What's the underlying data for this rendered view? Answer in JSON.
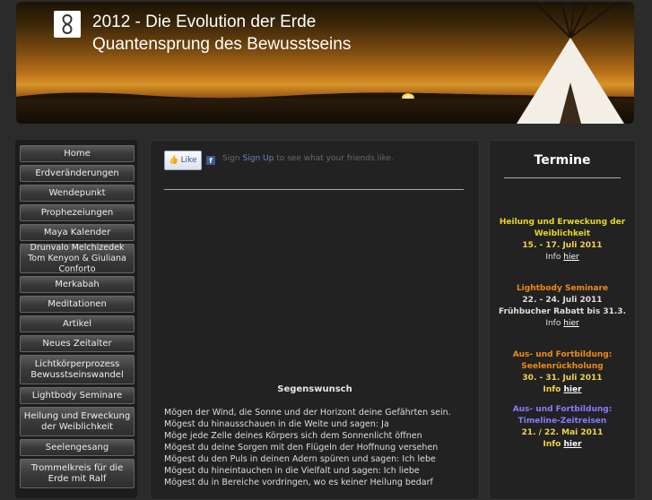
{
  "header": {
    "title_line1": "2012 - Die Evolution der Erde",
    "title_line2": "Quantensprung des Bewusstseins"
  },
  "nav": [
    "Home",
    "Erdveränderungen",
    "Wendepunkt",
    "Prophezeiungen",
    "Maya Kalender",
    "Drunvalo Melchizedek Tom Kenyon & Giuliana Conforto",
    "Merkabah",
    "Meditationen",
    "Artikel",
    "Neues Zeitalter",
    "Lichtkörperprozess Bewusstseinswandel",
    "Lightbody Seminare",
    "Heilung und Erweckung der Weiblichkeit",
    "Seelengesang",
    "Trommelkreis für die Erde mit Ralf"
  ],
  "facebook": {
    "like_label": "Like",
    "prefix": "Sign",
    "signup_label": "Sign Up",
    "suffix": "to see what your friends like."
  },
  "main": {
    "heading": "Segenswunsch",
    "lines": [
      "Mögen der Wind, die Sonne und der Horizont deine Gefährten sein.",
      "Mögest du hinausschauen in die Weite und sagen: Ja",
      "Möge jede Zelle deines Körpers sich dem Sonnenlicht öffnen",
      "Mögest du deine Sorgen mit den Flügeln der Hoffnung versehen",
      "Mögest du den Puls in deinen Adern spüren und sagen: Ich lebe",
      "Mögest du hineintauchen in die Vielfalt und sagen: Ich liebe",
      "Mögest du in Bereiche vordringen, wo es keiner Heilung bedarf"
    ]
  },
  "termine": {
    "title": "Termine",
    "events": [
      {
        "title": "Heilung und Erweckung der Weiblichkeit",
        "date": "15. - 17. Juli 2011",
        "extra": "",
        "info": "Info",
        "link": "hier",
        "color": "#e8d820"
      },
      {
        "title": "Lightbody Seminare",
        "date": "22. - 24. Juli 2011",
        "extra": "Frühbucher Rabatt bis 31.3.",
        "info": "Info",
        "link": "hier",
        "color": "#f08a10"
      },
      {
        "title": "Aus- und Fortbildung: Seelenrückholung",
        "date": "30. - 31. Juli 2011",
        "extra": "",
        "info": "Info",
        "link": "hier",
        "color": "#f08a10"
      },
      {
        "title": "Aus- und Fortbildung: Timeline-Zeitreisen",
        "date": "21. / 22. Mai 2011",
        "extra": "",
        "info": "Info",
        "link": "hier",
        "color": "#8a7aff"
      }
    ]
  },
  "colors": {
    "background": "#2b2b2b",
    "panel": "#222222",
    "date_text": "#f2d24a"
  }
}
